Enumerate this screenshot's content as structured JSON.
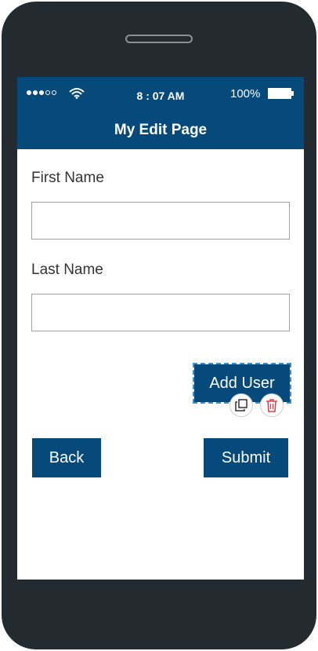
{
  "status_bar": {
    "signal_filled": 3,
    "signal_total": 5,
    "time": "8 : 07 AM",
    "battery": "100%"
  },
  "nav": {
    "title": "My Edit Page"
  },
  "form": {
    "first_name_label": "First Name",
    "first_name_value": "",
    "last_name_label": "Last Name",
    "last_name_value": ""
  },
  "buttons": {
    "add_user": "Add User",
    "back": "Back",
    "submit": "Submit"
  },
  "icons": {
    "copy": "copy-icon",
    "delete": "trash-icon"
  },
  "colors": {
    "brand": "#054a7a",
    "phone_body": "#242b30",
    "delete_red": "#d9434b",
    "selection_dash": "#3a8fd0"
  }
}
